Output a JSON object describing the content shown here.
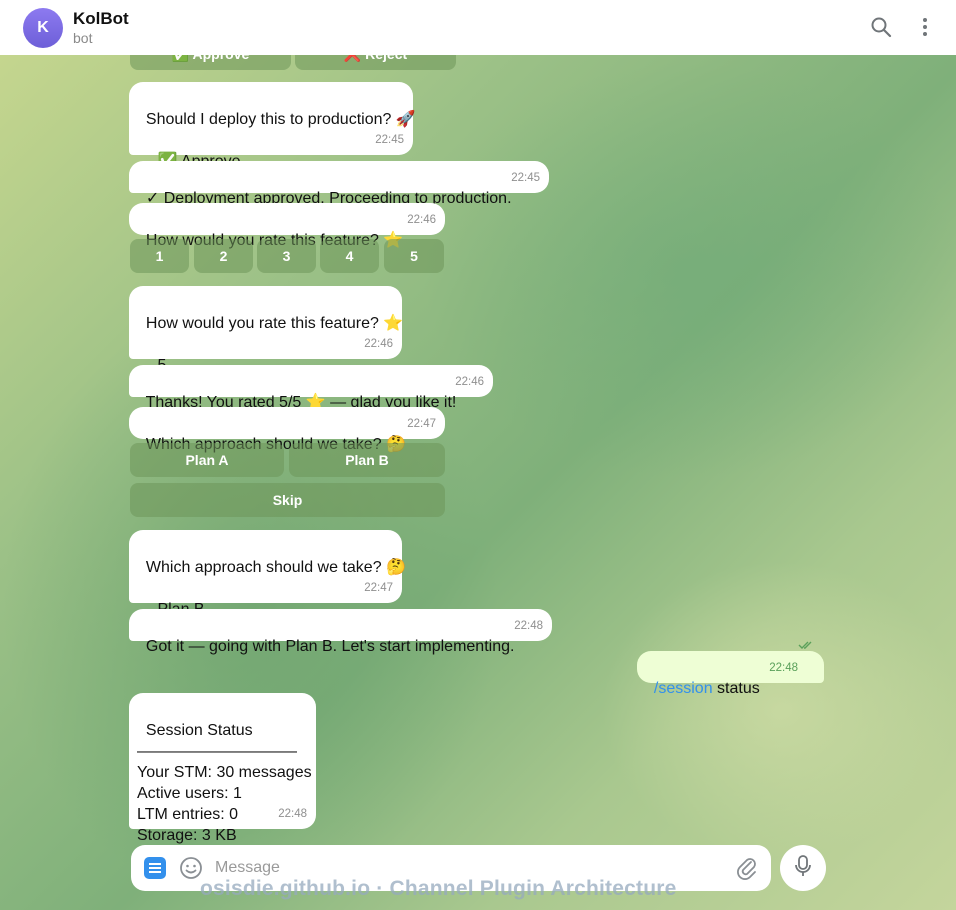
{
  "header": {
    "avatar_letter": "K",
    "title": "KolBot",
    "subtitle": "bot",
    "search_icon": "search-icon",
    "menu_icon": "more-vertical-icon"
  },
  "top_buttons": {
    "approve": "✅ Approve",
    "reject": "❌ Reject"
  },
  "messages": [
    {
      "text": "Should I deploy this to production? 🚀\n\n→ ✅ Approve",
      "time": "22:45"
    },
    {
      "text": "✓ Deployment approved. Proceeding to production.",
      "time": "22:45"
    },
    {
      "text": "How would you rate this feature? ⭐",
      "time": "22:46"
    },
    {
      "text": "How would you rate this feature? ⭐\n\n→ 5",
      "time": "22:46"
    },
    {
      "text": "Thanks! You rated 5/5 ⭐ — glad you like it!",
      "time": "22:46"
    },
    {
      "text": "Which approach should we take? 🤔",
      "time": "22:47"
    },
    {
      "text": "Which approach should we take? 🤔\n\n→ Plan B",
      "time": "22:47"
    },
    {
      "text": "Got it — going with Plan B. Let's start implementing.",
      "time": "22:48"
    },
    {
      "text": "Session Status\n——————————\nYour STM: 30 messages\nActive users: 1\nLTM entries: 0\nStorage: 3 KB",
      "time": "22:48"
    }
  ],
  "rating_buttons": [
    "1",
    "2",
    "3",
    "4",
    "5"
  ],
  "plan_buttons": {
    "plan_a": "Plan A",
    "plan_b": "Plan B",
    "skip": "Skip"
  },
  "outgoing": {
    "command": "/session",
    "text": " status",
    "time": "22:48",
    "status_icon": "double-check-icon"
  },
  "input": {
    "placeholder": "Message"
  },
  "watermark": "osisdie.github.io · Channel Plugin Architecture",
  "colors": {
    "accent": "#3390ec",
    "outgoing_bubble": "#eefed5",
    "avatar": "#7b6ae6"
  }
}
